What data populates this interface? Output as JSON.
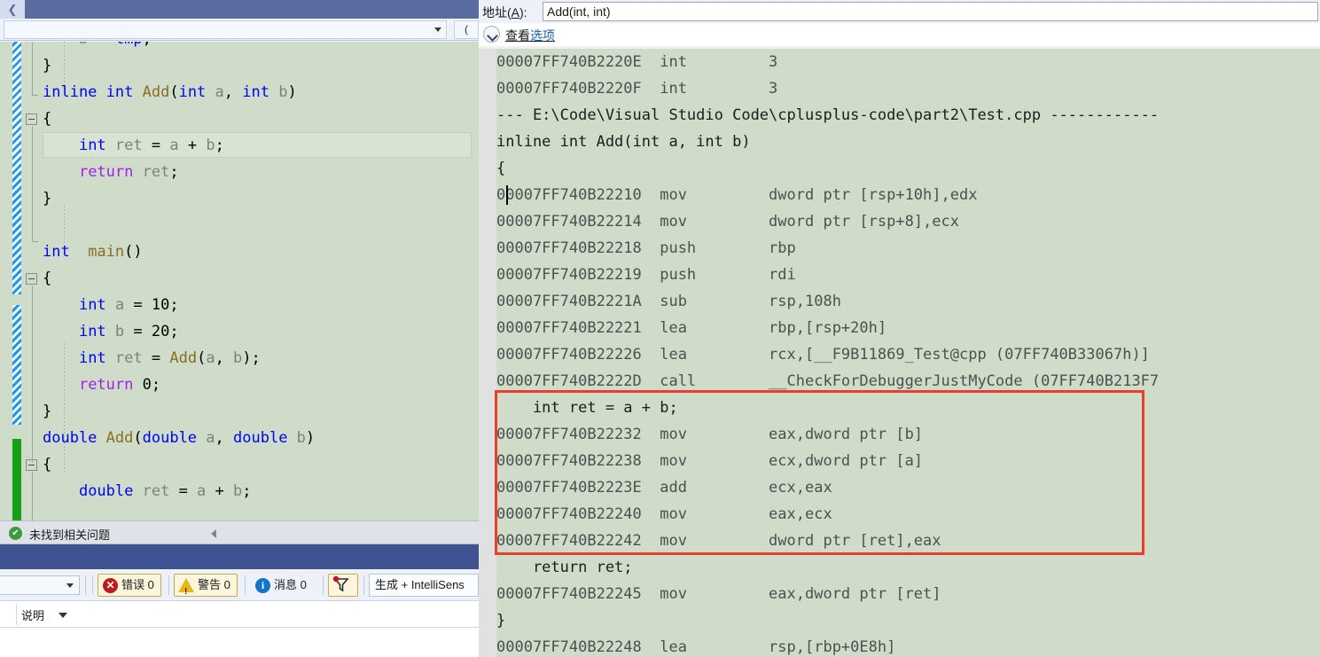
{
  "editor": {
    "nav_combo_value": "",
    "code_lines": [
      {
        "indent": 0,
        "segments": [
          {
            "t": "    ",
            "c": "pl"
          },
          {
            "t": "b",
            "c": "id"
          },
          {
            "t": " = ",
            "c": "pl"
          },
          {
            "t": "tmp",
            "c": "k"
          },
          {
            "t": ";",
            "c": "pl"
          }
        ]
      },
      {
        "indent": 0,
        "segments": [
          {
            "t": "}",
            "c": "pl"
          }
        ]
      },
      {
        "indent": 0,
        "segments": [
          {
            "t": "inline ",
            "c": "k"
          },
          {
            "t": "int ",
            "c": "k"
          },
          {
            "t": "Add",
            "c": "fn"
          },
          {
            "t": "(",
            "c": "pl"
          },
          {
            "t": "int ",
            "c": "k"
          },
          {
            "t": "a",
            "c": "id"
          },
          {
            "t": ", ",
            "c": "pl"
          },
          {
            "t": "int ",
            "c": "k"
          },
          {
            "t": "b",
            "c": "id"
          },
          {
            "t": ")",
            "c": "pl"
          }
        ]
      },
      {
        "indent": 0,
        "segments": [
          {
            "t": "{",
            "c": "pl"
          }
        ]
      },
      {
        "indent": 0,
        "segments": [
          {
            "t": "    ",
            "c": "pl"
          },
          {
            "t": "int ",
            "c": "k"
          },
          {
            "t": "ret",
            "c": "id"
          },
          {
            "t": " = ",
            "c": "pl"
          },
          {
            "t": "a",
            "c": "id"
          },
          {
            "t": " + ",
            "c": "pl"
          },
          {
            "t": "b",
            "c": "id"
          },
          {
            "t": ";",
            "c": "pl"
          }
        ]
      },
      {
        "indent": 0,
        "segments": [
          {
            "t": "    ",
            "c": "pl"
          },
          {
            "t": "return ",
            "c": "kw2"
          },
          {
            "t": "ret",
            "c": "id"
          },
          {
            "t": ";",
            "c": "pl"
          }
        ]
      },
      {
        "indent": 0,
        "segments": [
          {
            "t": "}",
            "c": "pl"
          }
        ]
      },
      {
        "indent": 0,
        "segments": []
      },
      {
        "indent": 0,
        "segments": [
          {
            "t": "int  ",
            "c": "k"
          },
          {
            "t": "main",
            "c": "fn"
          },
          {
            "t": "()",
            "c": "pl"
          }
        ]
      },
      {
        "indent": 0,
        "segments": [
          {
            "t": "{",
            "c": "pl"
          }
        ]
      },
      {
        "indent": 0,
        "segments": [
          {
            "t": "    ",
            "c": "pl"
          },
          {
            "t": "int ",
            "c": "k"
          },
          {
            "t": "a",
            "c": "id"
          },
          {
            "t": " = ",
            "c": "pl"
          },
          {
            "t": "10",
            "c": "num"
          },
          {
            "t": ";",
            "c": "pl"
          }
        ]
      },
      {
        "indent": 0,
        "segments": [
          {
            "t": "    ",
            "c": "pl"
          },
          {
            "t": "int ",
            "c": "k"
          },
          {
            "t": "b",
            "c": "id"
          },
          {
            "t": " = ",
            "c": "pl"
          },
          {
            "t": "20",
            "c": "num"
          },
          {
            "t": ";",
            "c": "pl"
          }
        ]
      },
      {
        "indent": 0,
        "segments": [
          {
            "t": "    ",
            "c": "pl"
          },
          {
            "t": "int ",
            "c": "k"
          },
          {
            "t": "ret",
            "c": "id"
          },
          {
            "t": " = ",
            "c": "pl"
          },
          {
            "t": "Add",
            "c": "fn"
          },
          {
            "t": "(",
            "c": "pl"
          },
          {
            "t": "a",
            "c": "id"
          },
          {
            "t": ", ",
            "c": "pl"
          },
          {
            "t": "b",
            "c": "id"
          },
          {
            "t": ");",
            "c": "pl"
          }
        ]
      },
      {
        "indent": 0,
        "segments": [
          {
            "t": "    ",
            "c": "pl"
          },
          {
            "t": "return ",
            "c": "kw2"
          },
          {
            "t": "0",
            "c": "num"
          },
          {
            "t": ";",
            "c": "pl"
          }
        ]
      },
      {
        "indent": 0,
        "segments": [
          {
            "t": "}",
            "c": "pl"
          }
        ]
      },
      {
        "indent": 0,
        "segments": [
          {
            "t": "double ",
            "c": "k"
          },
          {
            "t": "Add",
            "c": "fn"
          },
          {
            "t": "(",
            "c": "pl"
          },
          {
            "t": "double ",
            "c": "k"
          },
          {
            "t": "a",
            "c": "id"
          },
          {
            "t": ", ",
            "c": "pl"
          },
          {
            "t": "double ",
            "c": "k"
          },
          {
            "t": "b",
            "c": "id"
          },
          {
            "t": ")",
            "c": "pl"
          }
        ]
      },
      {
        "indent": 0,
        "segments": [
          {
            "t": "{",
            "c": "pl"
          }
        ]
      },
      {
        "indent": 0,
        "segments": [
          {
            "t": "    ",
            "c": "pl"
          },
          {
            "t": "double ",
            "c": "k"
          },
          {
            "t": "ret",
            "c": "id"
          },
          {
            "t": " = ",
            "c": "pl"
          },
          {
            "t": "a",
            "c": "id"
          },
          {
            "t": " + ",
            "c": "pl"
          },
          {
            "t": "b",
            "c": "id"
          },
          {
            "t": ";",
            "c": "pl"
          }
        ]
      }
    ]
  },
  "issue_bar": {
    "status_text": "未找到相关问题",
    "ok_glyph": "✔"
  },
  "error_list": {
    "error_label": "错误 0",
    "warning_label": "警告 0",
    "message_label": "消息 0",
    "build_filter": "生成 + IntelliSens",
    "error_glyph": "✕",
    "info_glyph": "i",
    "column_label": "说明"
  },
  "disassembly": {
    "address_label_pre": "地址(",
    "address_label_key": "A",
    "address_label_post": "):",
    "address_value": "Add(int, int)",
    "view_options_label_1": "查看",
    "view_options_label_2": "选项",
    "lines": [
      {
        "type": "asm",
        "text": "00007FF740B2220E  int         3"
      },
      {
        "type": "asm",
        "text": "00007FF740B2220F  int         3"
      },
      {
        "type": "file",
        "text": "--- E:\\Code\\Visual Studio Code\\cplusplus-code\\part2\\Test.cpp ------------"
      },
      {
        "type": "src",
        "text": "inline int Add(int a, int b)"
      },
      {
        "type": "src",
        "text": "{"
      },
      {
        "type": "asm",
        "text": "00007FF740B22210  mov         dword ptr [rsp+10h],edx",
        "caret": true
      },
      {
        "type": "asm",
        "text": "00007FF740B22214  mov         dword ptr [rsp+8],ecx"
      },
      {
        "type": "asm",
        "text": "00007FF740B22218  push        rbp"
      },
      {
        "type": "asm",
        "text": "00007FF740B22219  push        rdi"
      },
      {
        "type": "asm",
        "text": "00007FF740B2221A  sub         rsp,108h"
      },
      {
        "type": "asm",
        "text": "00007FF740B22221  lea         rbp,[rsp+20h]"
      },
      {
        "type": "asm",
        "text": "00007FF740B22226  lea         rcx,[__F9B11869_Test@cpp (07FF740B33067h)]"
      },
      {
        "type": "asm",
        "text": "00007FF740B2222D  call        __CheckForDebuggerJustMyCode (07FF740B213F7"
      },
      {
        "type": "src",
        "text": "    int ret = a + b;"
      },
      {
        "type": "asm",
        "text": "00007FF740B22232  mov         eax,dword ptr [b]"
      },
      {
        "type": "asm",
        "text": "00007FF740B22238  mov         ecx,dword ptr [a]"
      },
      {
        "type": "asm",
        "text": "00007FF740B2223E  add         ecx,eax"
      },
      {
        "type": "asm",
        "text": "00007FF740B22240  mov         eax,ecx"
      },
      {
        "type": "asm",
        "text": "00007FF740B22242  mov         dword ptr [ret],eax"
      },
      {
        "type": "src",
        "text": "    return ret;"
      },
      {
        "type": "asm",
        "text": "00007FF740B22245  mov         eax,dword ptr [ret]"
      },
      {
        "type": "src",
        "text": "}"
      },
      {
        "type": "asm",
        "text": "00007FF740B22248  lea         rsp,[rbp+0E8h]"
      }
    ],
    "highlight_box": {
      "color": "#ef3b2d",
      "first_line_index": 13,
      "last_line_index": 18
    }
  }
}
